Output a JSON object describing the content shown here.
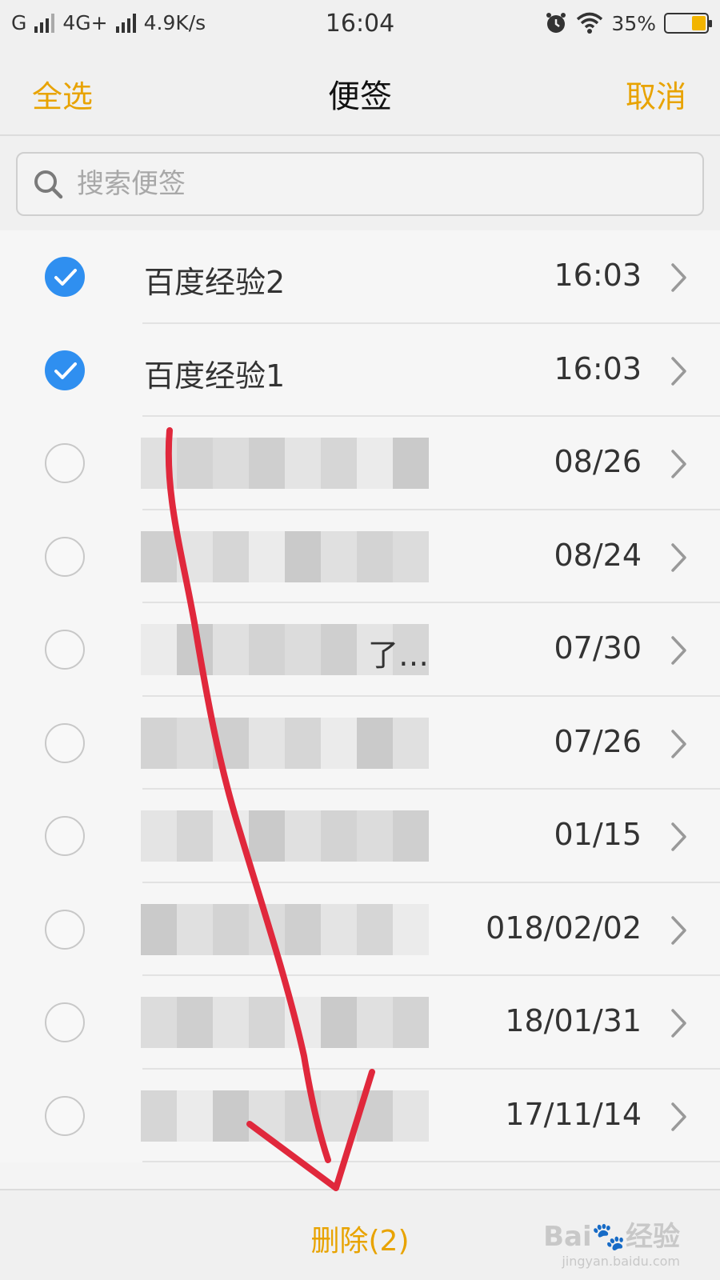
{
  "status_bar": {
    "carrier1": "G",
    "carrier2": "4G+",
    "speed": "4.9K/s",
    "time": "16:04",
    "battery": "35%",
    "battery_level": 0.35
  },
  "nav": {
    "select_all": "全选",
    "title": "便签",
    "cancel": "取消"
  },
  "search": {
    "placeholder": "搜索便签"
  },
  "notes": [
    {
      "title": "百度经验2",
      "date": "16:03",
      "checked": true
    },
    {
      "title": "百度经验1",
      "date": "16:03",
      "checked": true
    },
    {
      "title": "",
      "date": "08/26",
      "checked": false
    },
    {
      "title": "",
      "date": "08/24",
      "checked": false
    },
    {
      "title": "了…",
      "date": "07/30",
      "checked": false
    },
    {
      "title": "",
      "date": "07/26",
      "checked": false
    },
    {
      "title": "",
      "date": "01/15",
      "checked": false
    },
    {
      "title": "",
      "date": "018/02/02",
      "checked": false
    },
    {
      "title": "",
      "date": "18/01/31",
      "checked": false
    },
    {
      "title": "",
      "date": "17/11/14",
      "checked": false
    }
  ],
  "bottom": {
    "delete_label": "删除(2)"
  },
  "watermark": {
    "brand": "Bai",
    "brand2": "经验",
    "url": "jingyan.baidu.com"
  },
  "colors": {
    "accent": "#e8a300",
    "check_blue": "#2f8ff0",
    "annotation_red": "#e0283c"
  }
}
